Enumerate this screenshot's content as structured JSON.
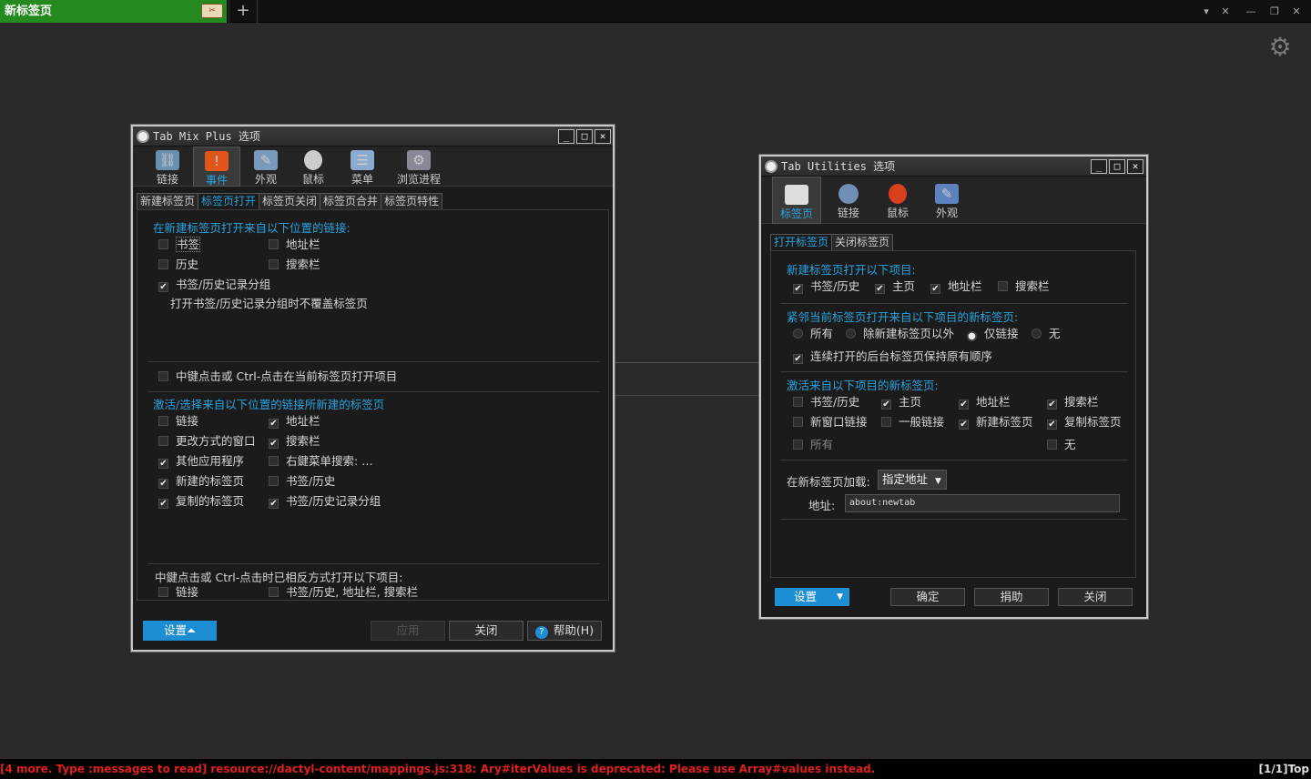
{
  "browser": {
    "tab_title": "新标签页",
    "new_tab": "+",
    "window_controls": [
      "▾",
      "✕",
      "—",
      "❐",
      "✕"
    ]
  },
  "tmp": {
    "title": "Tab Mix Plus 选项",
    "title_buttons": [
      "_",
      "□",
      "✕"
    ],
    "toolbar": [
      {
        "label": "链接",
        "icon": "link-icon"
      },
      {
        "label": "事件",
        "icon": "event-icon"
      },
      {
        "label": "外观",
        "icon": "appearance-icon"
      },
      {
        "label": "鼠标",
        "icon": "mouse-icon"
      },
      {
        "label": "菜单",
        "icon": "menu-icon"
      },
      {
        "label": "浏览进程",
        "icon": "session-icon"
      }
    ],
    "subtabs": [
      "新建标签页",
      "标签页打开",
      "标签页关闭",
      "标签页合并",
      "标签页特性"
    ],
    "section1": "在新建标签页打开来自以下位置的链接:",
    "s1_items": [
      {
        "label": "书签",
        "checked": false
      },
      {
        "label": "地址栏",
        "checked": false
      },
      {
        "label": "历史",
        "checked": false
      },
      {
        "label": "搜索栏",
        "checked": false
      },
      {
        "label": "书签/历史记录分组",
        "checked": true
      }
    ],
    "s1_note": "打开书签/历史记录分组时不覆盖标签页",
    "middle_click": {
      "label": "中键点击或 Ctrl-点击在当前标签页打开项目",
      "checked": false
    },
    "section2": "激活/选择来自以下位置的链接所新建的标签页",
    "s2_items": [
      {
        "label": "链接",
        "checked": false
      },
      {
        "label": "地址栏",
        "checked": true
      },
      {
        "label": "更改方式的窗口",
        "checked": false
      },
      {
        "label": "搜索栏",
        "checked": true
      },
      {
        "label": "其他应用程序",
        "checked": true
      },
      {
        "label": "右鍵菜单搜索: …",
        "checked": false
      },
      {
        "label": "新建的标签页",
        "checked": true
      },
      {
        "label": "书签/历史",
        "checked": false
      },
      {
        "label": "复制的标签页",
        "checked": true
      },
      {
        "label": "书签/历史记录分组",
        "checked": true
      }
    ],
    "section3": "中鍵点击或 Ctrl-点击时已相反方式打开以下项目:",
    "s3_items": [
      {
        "label": "链接",
        "checked": false
      },
      {
        "label": "书签/历史, 地址栏, 搜索栏",
        "checked": false
      }
    ],
    "buttons": {
      "settings": "设置",
      "apply": "应用",
      "close": "关闭",
      "help": "帮助(H)"
    }
  },
  "tu": {
    "title": "Tab Utilities 选项",
    "title_buttons": [
      "_",
      "□",
      "✕"
    ],
    "toolbar": [
      {
        "label": "标签页",
        "icon": "tabs-icon"
      },
      {
        "label": "链接",
        "icon": "globe-icon"
      },
      {
        "label": "鼠标",
        "icon": "mouse-icon"
      },
      {
        "label": "外观",
        "icon": "appearance-icon"
      }
    ],
    "subtabs": [
      "打开标签页",
      "关闭标签页"
    ],
    "section1": "新建标签页打开以下项目:",
    "s1_items": [
      {
        "label": "书签/历史",
        "checked": true
      },
      {
        "label": "主页",
        "checked": true
      },
      {
        "label": "地址栏",
        "checked": true
      },
      {
        "label": "搜索栏",
        "checked": false
      }
    ],
    "section2": "紧邻当前标签页打开来自以下项目的新标签页:",
    "s2_radios": [
      {
        "label": "所有",
        "checked": false
      },
      {
        "label": "除新建标签页以外",
        "checked": false
      },
      {
        "label": "仅链接",
        "checked": true
      },
      {
        "label": "无",
        "checked": false
      }
    ],
    "s2_check": {
      "label": "连续打开的后台标签页保持原有顺序",
      "checked": true
    },
    "section3": "激活来自以下项目的新标签页:",
    "s3_items": [
      {
        "label": "书签/历史",
        "checked": false
      },
      {
        "label": "主页",
        "checked": true
      },
      {
        "label": "地址栏",
        "checked": true
      },
      {
        "label": "搜索栏",
        "checked": true
      },
      {
        "label": "新窗口链接",
        "checked": false
      },
      {
        "label": "一般链接",
        "checked": false
      },
      {
        "label": "新建标签页",
        "checked": true
      },
      {
        "label": "复制标签页",
        "checked": true
      },
      {
        "label": "所有",
        "checked": false
      },
      {
        "label": "无",
        "checked": false
      }
    ],
    "load_label": "在新标签页加载:",
    "load_value": "指定地址",
    "addr_label": "地址:",
    "addr_value": "about:newtab",
    "buttons": {
      "settings": "设置",
      "ok": "确定",
      "donate": "捐助",
      "close": "关闭"
    }
  },
  "status": {
    "count": "[4 more. Type :messages to read]",
    "message": "resource://dactyl-content/mappings.js:318: Ary#iterValues is deprecated: Please use Array#values instead.",
    "position": "[1/1]Top"
  }
}
